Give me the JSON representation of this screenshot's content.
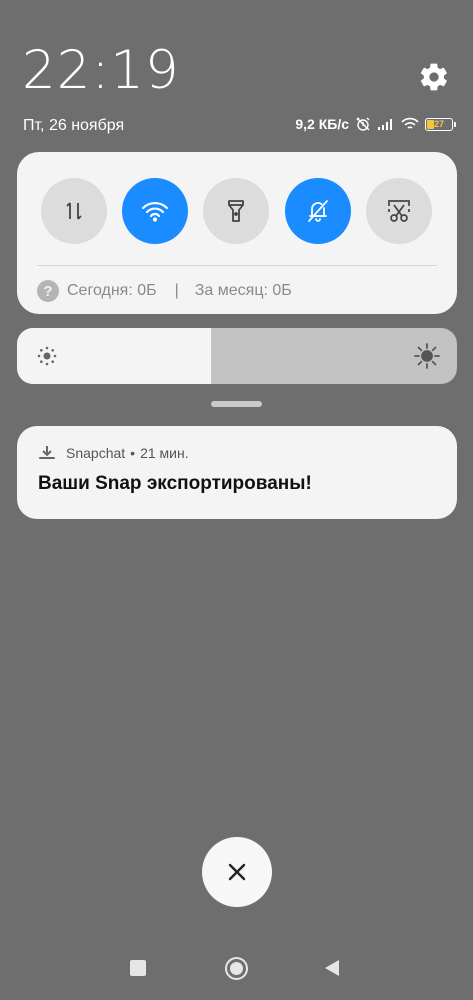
{
  "status": {
    "time": "22:19",
    "date": "Пт, 26 ноября",
    "net_speed": "9,2 КБ/с",
    "battery": "27",
    "icons": [
      "alarm-off-icon",
      "signal-icon",
      "wifi-icon",
      "battery-icon"
    ]
  },
  "quick_settings": {
    "toggles": [
      {
        "name": "mobile-data",
        "icon": "data-arrows-icon",
        "on": false
      },
      {
        "name": "wifi",
        "icon": "wifi-icon",
        "on": true
      },
      {
        "name": "flashlight",
        "icon": "flashlight-icon",
        "on": false
      },
      {
        "name": "silent",
        "icon": "bell-off-icon",
        "on": true
      },
      {
        "name": "screenshot",
        "icon": "scissors-icon",
        "on": false
      }
    ],
    "help_glyph": "?",
    "today": "Сегодня: 0Б",
    "separator": "|",
    "month": "За месяц: 0Б"
  },
  "brightness": {
    "level": 0.44
  },
  "notification": {
    "app": "Snapchat",
    "dot": "•",
    "time": "21 мин.",
    "title": "Ваши Snap экспортированы!"
  },
  "colors": {
    "accent": "#1a8cff",
    "background": "#6e6e6e",
    "panel": "#f4f4f4"
  }
}
